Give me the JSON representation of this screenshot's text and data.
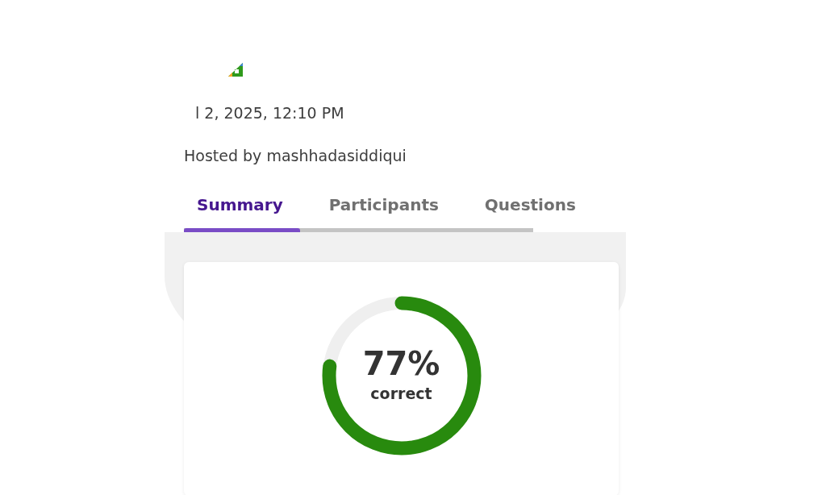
{
  "header": {
    "date": "l 2, 2025, 12:10 PM",
    "host": "Hosted by mashhadasiddiqui"
  },
  "tabs": [
    {
      "label": "Summary",
      "selected": true
    },
    {
      "label": "Participants",
      "selected": false
    },
    {
      "label": "Questions",
      "selected": false
    }
  ],
  "summary": {
    "accuracy": {
      "level": 0.77,
      "value": "77%",
      "label": "correct"
    }
  }
}
